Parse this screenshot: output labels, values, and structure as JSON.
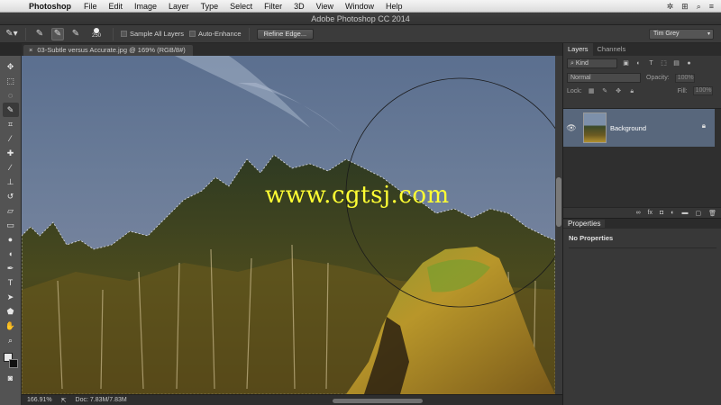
{
  "menubar": {
    "apple_icon": "apple-icon",
    "app_name": "Photoshop",
    "items": [
      "File",
      "Edit",
      "Image",
      "Layer",
      "Type",
      "Select",
      "Filter",
      "3D",
      "View",
      "Window",
      "Help"
    ]
  },
  "window": {
    "title": "Adobe Photoshop CC 2014"
  },
  "options": {
    "brush_size": "250",
    "sample_all_layers": "Sample All Layers",
    "auto_enhance": "Auto-Enhance",
    "refine_edge": "Refine Edge...",
    "workspace": "Tim Grey"
  },
  "document": {
    "tab_title": "03-Subtle versus Accurate.jpg @ 169% (RGB/8#)",
    "watermark": "www.cgtsj.com"
  },
  "status": {
    "zoom": "166.91%",
    "doc_size": "Doc: 7.83M/7.83M"
  },
  "layers_panel": {
    "tabs": [
      "Layers",
      "Channels"
    ],
    "kind_label": "Kind",
    "blend_mode": "Normal",
    "opacity_label": "Opacity:",
    "opacity_value": "100%",
    "lock_label": "Lock:",
    "fill_label": "Fill:",
    "fill_value": "100%",
    "layers": [
      {
        "name": "Background"
      }
    ]
  },
  "properties_panel": {
    "tab": "Properties",
    "message": "No Properties"
  }
}
